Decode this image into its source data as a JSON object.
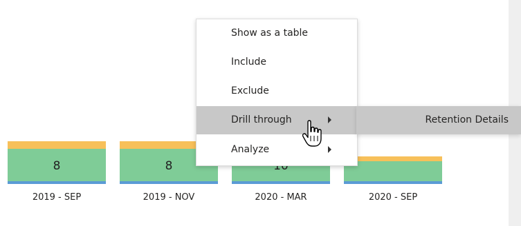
{
  "chart_data": {
    "type": "bar",
    "categories": [
      "2019 - SEP",
      "2019 - NOV",
      "2020 - MAR",
      "2020 - SEP"
    ],
    "series": [
      {
        "values": [
          1,
          1,
          1,
          1
        ]
      },
      {
        "values": [
          8,
          8,
          10,
          0
        ]
      },
      {
        "values": [
          1,
          1,
          1,
          1
        ]
      }
    ],
    "data_labels": [
      "8",
      "8",
      "10",
      ""
    ],
    "colors": [
      "#5b9bd5",
      "#7fcc97",
      "#f7c05a"
    ]
  },
  "context_menu": {
    "items": [
      {
        "label": "Show as a table"
      },
      {
        "label": "Include"
      },
      {
        "label": "Exclude"
      },
      {
        "label": "Drill through"
      },
      {
        "label": "Analyze"
      }
    ],
    "highlight_color": "#c8c8c8"
  },
  "submenu": {
    "items": [
      {
        "label": "Retention Details"
      }
    ]
  },
  "cursor": {
    "icon": "hand-pointer-icon"
  }
}
